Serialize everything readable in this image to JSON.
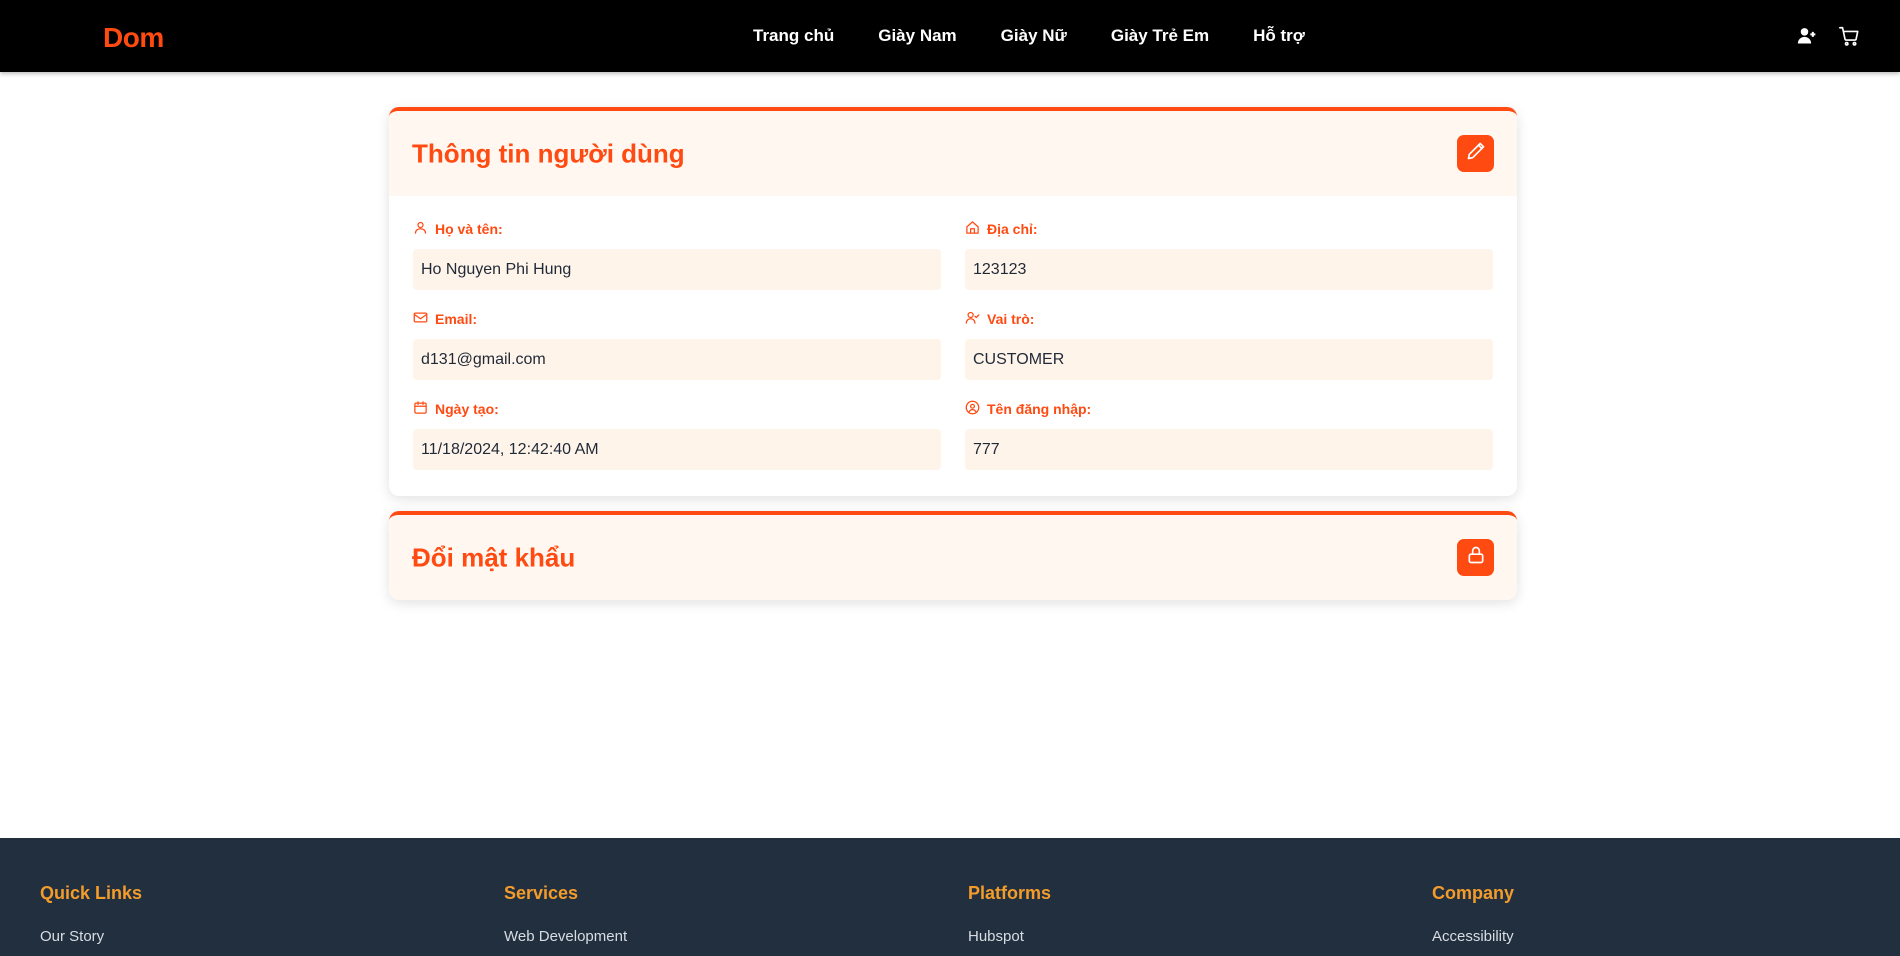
{
  "header": {
    "logo": "Dom",
    "nav": [
      "Trang chủ",
      "Giày Nam",
      "Giày Nữ",
      "Giày Trẻ Em",
      "Hỗ trợ"
    ],
    "icons": [
      "user-add-icon",
      "cart-icon"
    ]
  },
  "profile": {
    "title": "Thông tin người dùng",
    "fields": [
      {
        "label": "Họ và tên:",
        "value": "Ho Nguyen Phi Hung",
        "icon": "user-icon"
      },
      {
        "label": "Địa chỉ:",
        "value": "123123",
        "icon": "home-icon"
      },
      {
        "label": "Email:",
        "value": "d131@gmail.com",
        "icon": "mail-icon"
      },
      {
        "label": "Vai trò:",
        "value": "CUSTOMER",
        "icon": "user-check-icon"
      },
      {
        "label": "Ngày tạo:",
        "value": "11/18/2024, 12:42:40 AM",
        "icon": "calendar-icon"
      },
      {
        "label": "Tên đăng nhập:",
        "value": "777",
        "icon": "user-circle-icon"
      }
    ]
  },
  "password": {
    "title": "Đổi mật khẩu"
  },
  "footer": {
    "columns": [
      {
        "heading": "Quick Links",
        "link": "Our Story"
      },
      {
        "heading": "Services",
        "link": "Web Development"
      },
      {
        "heading": "Platforms",
        "link": "Hubspot"
      },
      {
        "heading": "Company",
        "link": "Accessibility"
      }
    ]
  },
  "colors": {
    "accent": "#ff4a11",
    "header_bg": "#000000",
    "field_bg": "#fff4ea",
    "footer_bg": "#212f3f",
    "footer_heading": "#f39c2b"
  }
}
